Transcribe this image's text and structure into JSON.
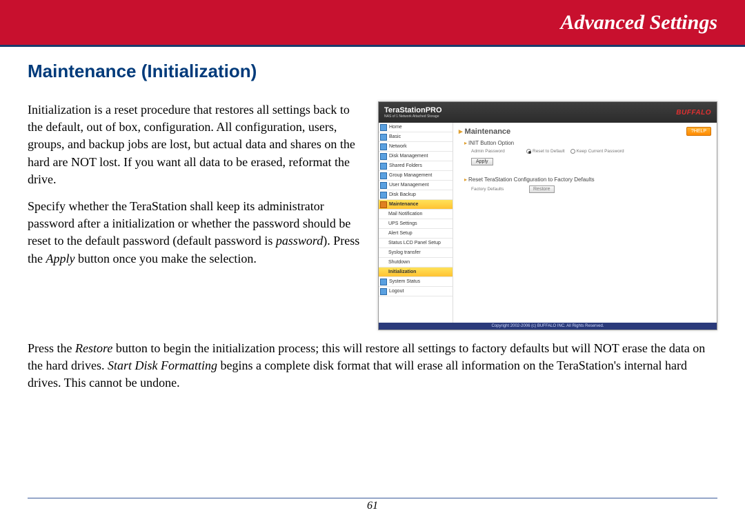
{
  "banner": {
    "title": "Advanced Settings"
  },
  "heading": "Maintenance (Initialization)",
  "para1": "Initialization is a reset procedure that restores all settings back to the default, out of box, configuration.  All configuration, users, groups, and backup jobs are lost, but actual data and shares on the hard are NOT lost.  If you want all data to be erased, reformat the drive.",
  "para2a": "Specify whether the TeraStation shall keep its administrator password after a initialization or whether the password should be reset to the default password (default password is ",
  "para2_pw": "password",
  "para2b": ").   Press the ",
  "para2_apply": "Apply",
  "para2c": " button once you make the selection.",
  "para3a": "Press the ",
  "para3_restore": "Restore",
  "para3b": " button to begin the initialization process; this will restore all settings to factory defaults but will NOT erase the data on the hard drives.   ",
  "para3_sdf": "Start Disk Formatting",
  "para3c": " begins a complete disk format that will erase all information on the TeraStation's internal hard drives.  This cannot be undone.",
  "page_number": "61",
  "shot": {
    "product": "TeraStationPRO",
    "product_sub": "NAS of 1 Network Attached Storage",
    "brand": "BUFFALO",
    "sidebar": [
      {
        "label": "Home",
        "type": "top"
      },
      {
        "label": "Basic",
        "type": "top"
      },
      {
        "label": "Network",
        "type": "top"
      },
      {
        "label": "Disk Management",
        "type": "top"
      },
      {
        "label": "Shared Folders",
        "type": "top"
      },
      {
        "label": "Group Management",
        "type": "top"
      },
      {
        "label": "User Management",
        "type": "top"
      },
      {
        "label": "Disk Backup",
        "type": "top"
      },
      {
        "label": "Maintenance",
        "type": "sel"
      },
      {
        "label": "Mail Notification",
        "type": "sub"
      },
      {
        "label": "UPS Settings",
        "type": "sub"
      },
      {
        "label": "Alert Setup",
        "type": "sub"
      },
      {
        "label": "Status LCD Panel Setup",
        "type": "sub"
      },
      {
        "label": "Syslog transfer",
        "type": "sub"
      },
      {
        "label": "Shutdown",
        "type": "sub"
      },
      {
        "label": "Initialization",
        "type": "sub2"
      },
      {
        "label": "System Status",
        "type": "top"
      },
      {
        "label": "Logout",
        "type": "top"
      }
    ],
    "main_title": "Maintenance",
    "help_label": "?HELP",
    "section1": "INIT Button Option",
    "admin_pw_label": "Admin Password",
    "radio1": "Reset to Default",
    "radio2": "Keep Current Password",
    "apply_btn": "Apply",
    "section2": "Reset TeraStation Configuration to Factory Defaults",
    "factory_label": "Factory Defaults",
    "restore_btn": "Restore",
    "footer": "Copyright 2002-2006 (c) BUFFALO INC. All Rights Reserved."
  }
}
